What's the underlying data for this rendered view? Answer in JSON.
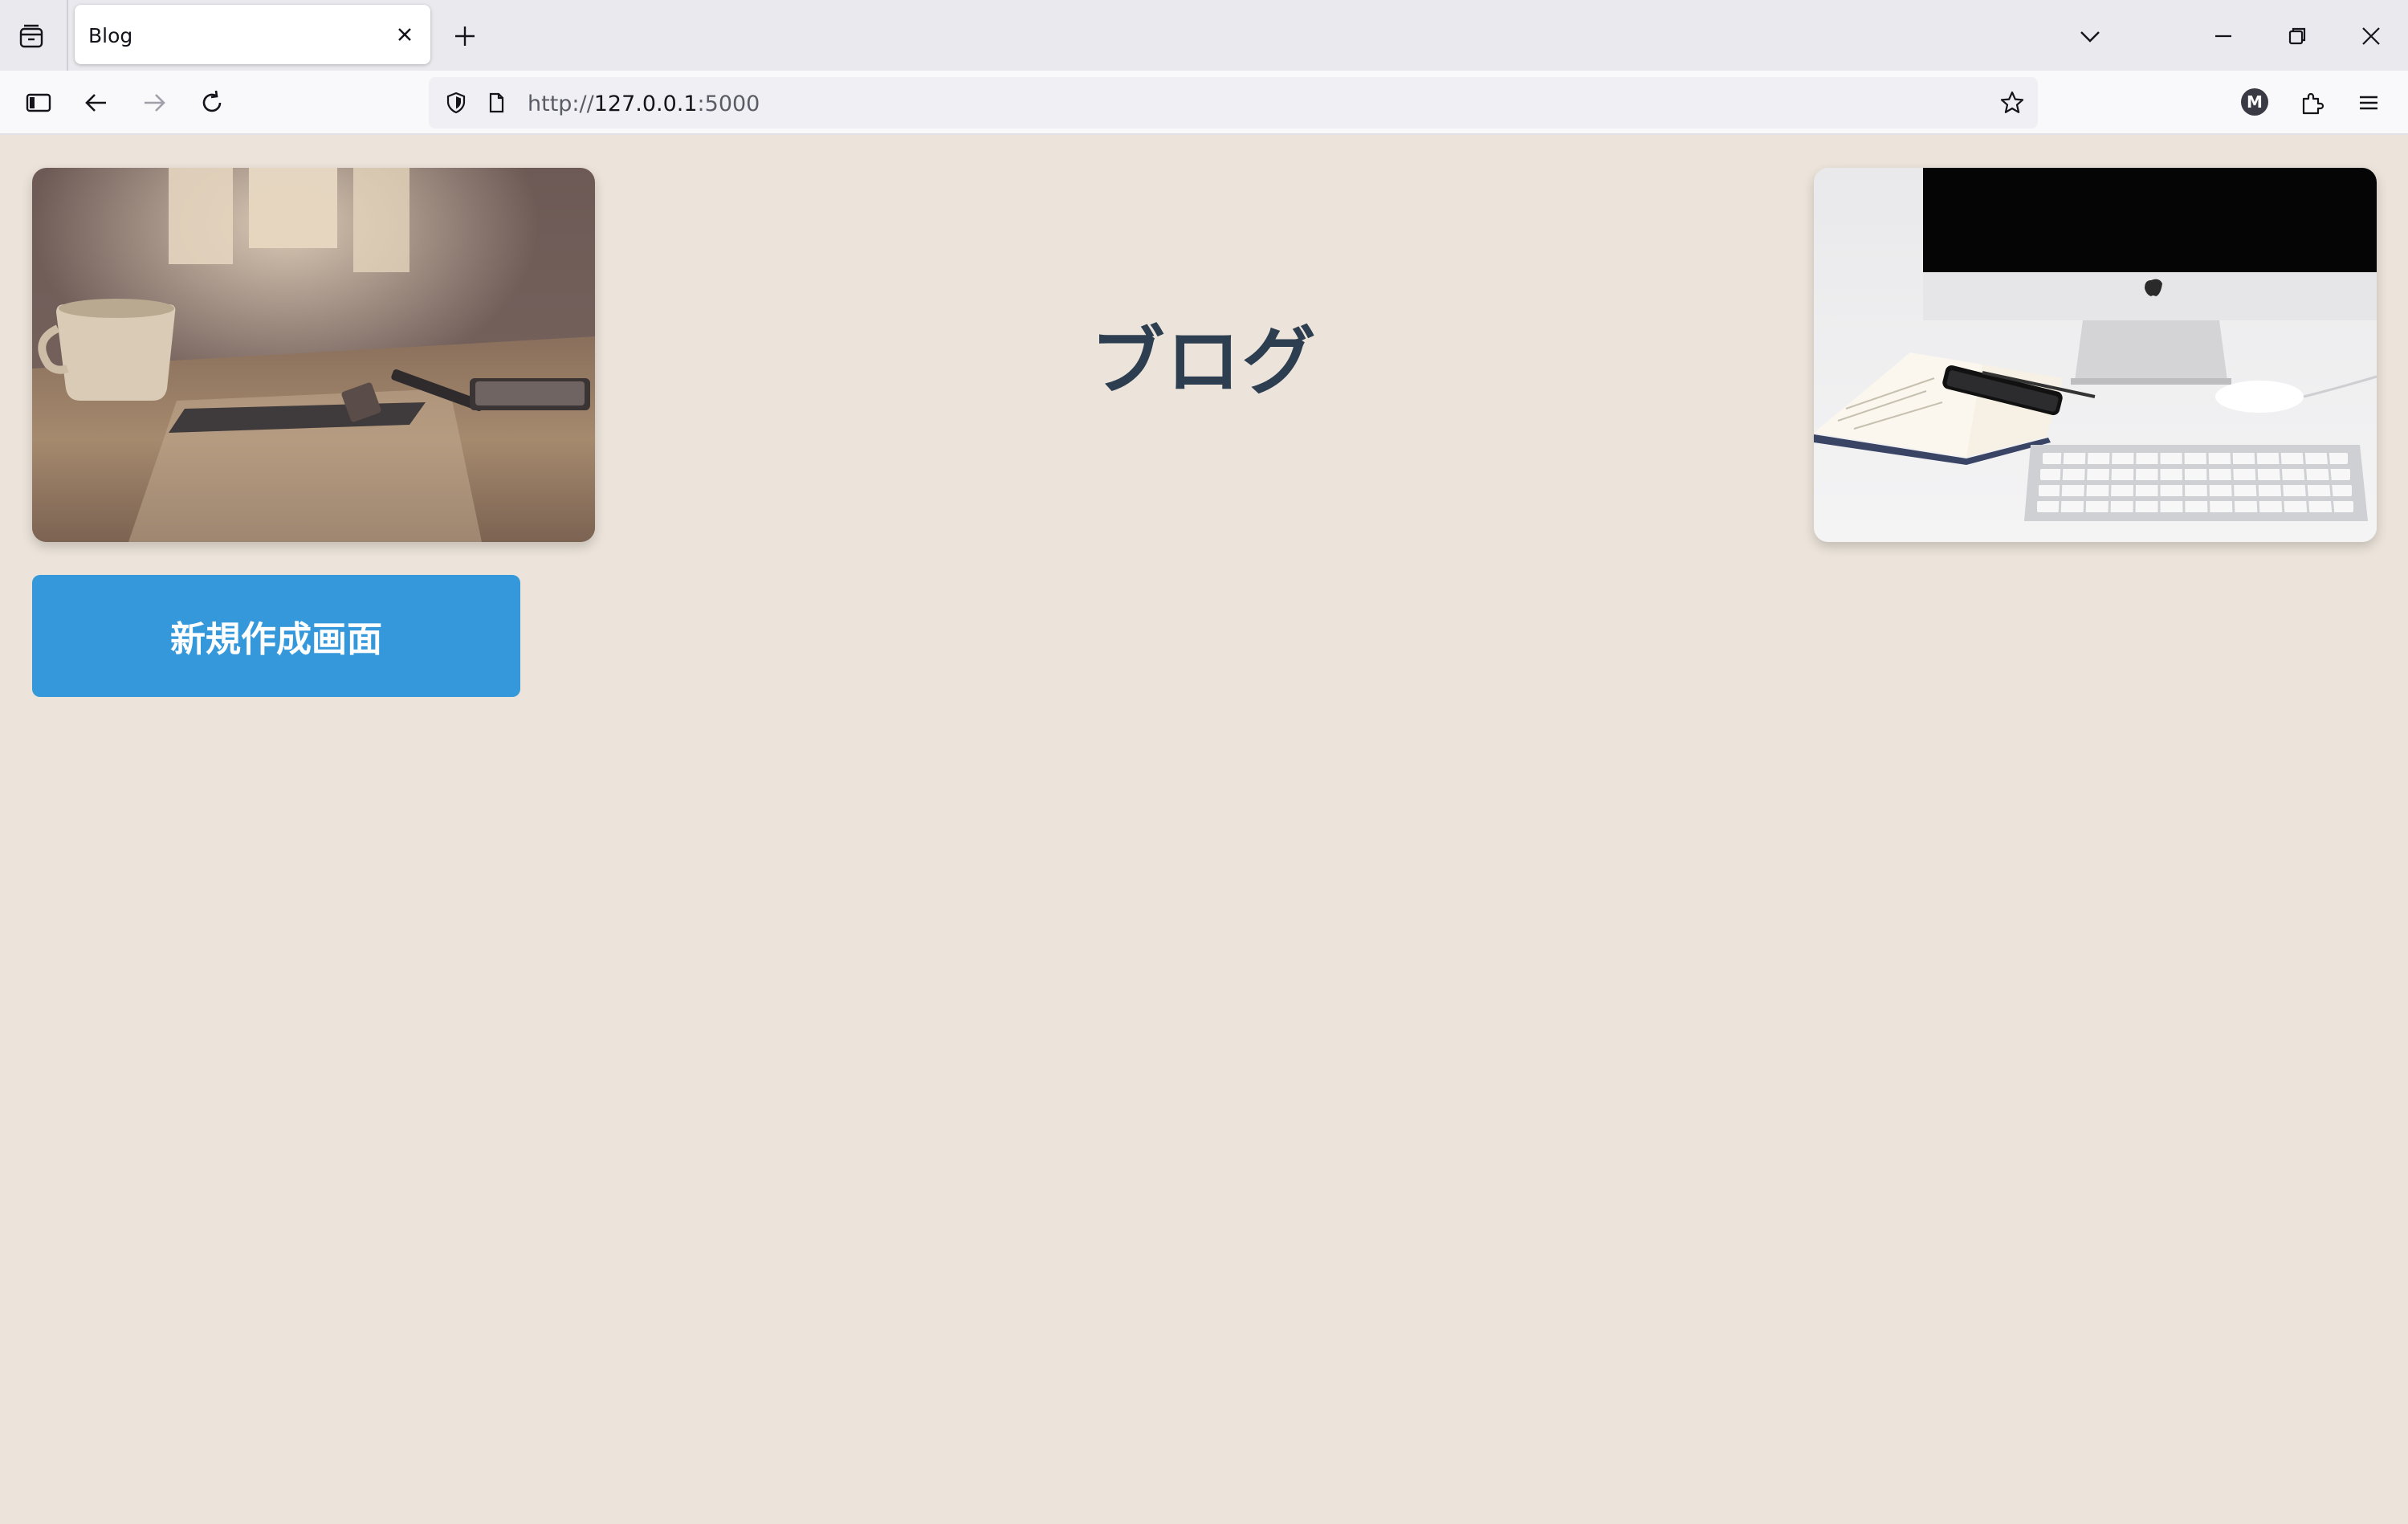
{
  "browser": {
    "tab_title": "Blog",
    "url_scheme": "http://",
    "url_host": "127.0.0.1",
    "url_port": ":5000",
    "profile_initial": "M"
  },
  "page": {
    "title": "ブログ",
    "new_button_label": "新規作成画面",
    "images": [
      {
        "name": "desk-coffee-photo",
        "tone": "sepia desk with coffee cup, notebook, pens"
      },
      {
        "name": "imac-workspace-photo",
        "tone": "white desk with iMac, keyboard, mouse, open book, phone"
      }
    ]
  },
  "colors": {
    "page_background": "#ece4da",
    "title_text": "#2c3e50",
    "button_background": "#3498db",
    "button_text": "#ffffff"
  },
  "icons": {
    "tab_list": "tab-list-icon",
    "tab_close": "close-icon",
    "new_tab": "plus-icon",
    "list_all_tabs": "chevron-down-icon",
    "minimize": "minimize-icon",
    "restore": "restore-icon",
    "close_window": "close-icon",
    "sidebar": "sidebar-icon",
    "back": "arrow-left-icon",
    "forward": "arrow-right-icon",
    "reload": "reload-icon",
    "tracking_protection": "shield-icon",
    "page_info": "page-icon",
    "bookmark": "star-icon",
    "extensions": "puzzle-icon",
    "menu": "hamburger-icon"
  }
}
